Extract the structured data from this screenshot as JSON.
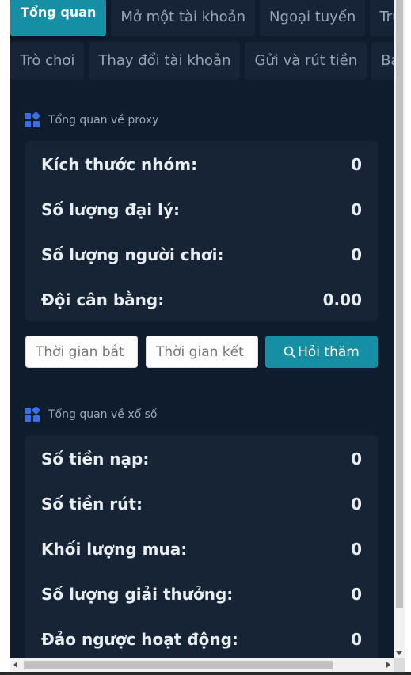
{
  "tabs_row1": [
    "Tổng quan",
    "Mở một tài khoản",
    "Ngoại tuyến",
    "Trực tuyến"
  ],
  "tabs_row2": [
    "Trò chơi",
    "Thay đổi tài khoản",
    "Gửi và rút tiền",
    "Báo cáo"
  ],
  "proxy_section": {
    "title": "Tổng quan về proxy",
    "rows": [
      {
        "label": "Kích thước nhóm:",
        "value": "0"
      },
      {
        "label": "Số lượng đại lý:",
        "value": "0"
      },
      {
        "label": "Số lượng người chơi:",
        "value": "0"
      },
      {
        "label": "Đội cân bằng:",
        "value": "0.00"
      }
    ]
  },
  "filters": {
    "start_placeholder": "Thời gian bắt đầu",
    "end_placeholder": "Thời gian kết thúc",
    "search_label": "Hỏi thăm"
  },
  "lottery_section": {
    "title": "Tổng quan về xổ số",
    "rows": [
      {
        "label": "Số tiền nạp:",
        "value": "0"
      },
      {
        "label": "Số tiền rút:",
        "value": "0"
      },
      {
        "label": "Khối lượng mua:",
        "value": "0"
      },
      {
        "label": "Số lượng giải thưởng:",
        "value": "0"
      },
      {
        "label": "Đảo ngược hoạt động:",
        "value": "0"
      }
    ]
  },
  "colors": {
    "accent": "#168ea3",
    "panel": "#0f1c2e",
    "card": "#162436",
    "icon": "#3b6fe0"
  }
}
